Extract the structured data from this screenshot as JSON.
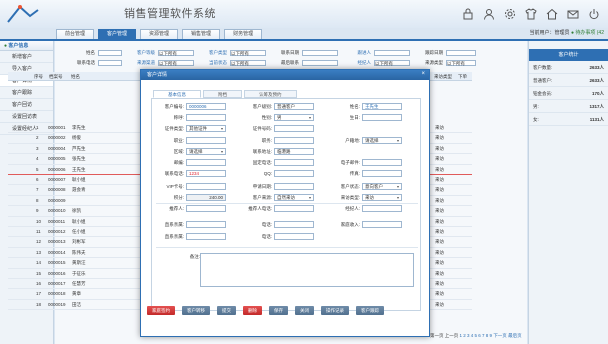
{
  "app": {
    "title": "销售管理软件系统"
  },
  "nav_tabs": [
    "前台管理",
    "客户管理",
    "资源管理",
    "销售管理",
    "财务管理"
  ],
  "header_icons": [
    "lock-icon",
    "user-icon",
    "gear-icon",
    "shirt-icon",
    "home-icon",
    "email-icon",
    "power-icon"
  ],
  "user_bar": {
    "label": "当前用户：",
    "user": "管理员",
    "pending": "待办事项 (42"
  },
  "sidebar": {
    "title": "客户信息",
    "items": [
      "新增客户",
      "导入客户",
      "客户详情",
      "客户跟踪",
      "客户回访",
      "设置回访表",
      "设置经纪人"
    ]
  },
  "filters": {
    "row1": [
      {
        "label": "姓名"
      },
      {
        "label": "客户等级",
        "value": "以下所有"
      },
      {
        "label": "客户类型",
        "value": "以下所有"
      },
      {
        "label": "联系日期"
      },
      {
        "label": "跟进人"
      },
      {
        "label": "跟踪日期"
      }
    ],
    "row2": [
      {
        "label": "联系电话"
      },
      {
        "label": "来源渠道",
        "value": "以下所有"
      },
      {
        "label": "当前状态",
        "value": "以下所有"
      },
      {
        "label": "最后联系"
      },
      {
        "label": "经纪人",
        "value": "以下所有"
      },
      {
        "label": "来源类型",
        "value": "以下所有"
      }
    ]
  },
  "grid": {
    "headers": [
      "序号",
      "档案号",
      "姓名",
      "部门",
      "来访类型",
      "下单"
    ],
    "rows": [
      {
        "no": "1",
        "id": "0000001",
        "name": "李先生",
        "type": "来访"
      },
      {
        "no": "2",
        "id": "0000002",
        "name": "杨俊",
        "type": "来访"
      },
      {
        "no": "3",
        "id": "0000004",
        "name": "芦先生",
        "type": "来访"
      },
      {
        "no": "4",
        "id": "0000005",
        "name": "张先生",
        "type": "来访"
      },
      {
        "no": "5",
        "id": "0000006",
        "name": "王先生",
        "type": "来访"
      },
      {
        "no": "6",
        "id": "0000007",
        "name": "耿小姐",
        "type": "来访"
      },
      {
        "no": "7",
        "id": "0000008",
        "name": "聂会青",
        "type": "来访"
      },
      {
        "no": "8",
        "id": "0000009",
        "name": "",
        "type": "来访"
      },
      {
        "no": "9",
        "id": "0000010",
        "name": "徐凯",
        "type": "来访"
      },
      {
        "no": "10",
        "id": "0000011",
        "name": "耿小姐",
        "type": "来访"
      },
      {
        "no": "11",
        "id": "0000012",
        "name": "任小姐",
        "type": "来访"
      },
      {
        "no": "12",
        "id": "0000013",
        "name": "刘彬军",
        "type": "来访"
      },
      {
        "no": "13",
        "id": "0000014",
        "name": "陈伟夫",
        "type": "来访"
      },
      {
        "no": "14",
        "id": "0000015",
        "name": "黄斯汪",
        "type": "来访"
      },
      {
        "no": "15",
        "id": "0000016",
        "name": "于征乐",
        "type": "来访"
      },
      {
        "no": "16",
        "id": "0000017",
        "name": "任慧芳",
        "type": "来访"
      },
      {
        "no": "17",
        "id": "0000018",
        "name": "黄章",
        "type": "来访"
      },
      {
        "no": "18",
        "id": "0000019",
        "name": "田洁",
        "type": "来访"
      }
    ]
  },
  "right_panel": {
    "title": "客户统计",
    "rows": [
      {
        "label": "客户数量:",
        "value": "2633人"
      },
      {
        "label": "普通客户:",
        "value": "2633人"
      },
      {
        "label": "铂金会员:",
        "value": "170人"
      },
      {
        "label": "男:",
        "value": "1317人"
      },
      {
        "label": "女:",
        "value": "1131人"
      }
    ]
  },
  "pager": {
    "text": "第一页 上一页",
    "pages": "1 2 3 4 5 6 7 8 9",
    "next": "下一页",
    "last": "最后页"
  },
  "modal": {
    "title": "客户详情",
    "close": "×",
    "tabs": [
      "基本信息",
      "附档",
      "认筹及预约"
    ],
    "fields": {
      "cust_no": {
        "label": "客户编号:",
        "value": "0000006"
      },
      "level": {
        "label": "客户级别:",
        "value": "普通客户"
      },
      "name": {
        "label": "姓名:",
        "value": "王先生"
      },
      "title": {
        "label": "称呼:",
        "value": ""
      },
      "gender": {
        "label": "性别:",
        "value": "男"
      },
      "birthday": {
        "label": "生日:",
        "value": ""
      },
      "id_type": {
        "label": "证件类型:",
        "value": "其他证件"
      },
      "id_no": {
        "label": "证件号码:",
        "value": ""
      },
      "job": {
        "label": "职业:",
        "value": ""
      },
      "position": {
        "label": "职务:",
        "value": ""
      },
      "hukou": {
        "label": "户籍地:",
        "value": "请选择"
      },
      "region": {
        "label": "区域:",
        "value": "请选择"
      },
      "address": {
        "label": "联系地址:",
        "value": "临港路"
      },
      "postcode": {
        "label": "邮编:",
        "value": ""
      },
      "phone": {
        "label": "固定电话:",
        "value": ""
      },
      "email": {
        "label": "电子邮件:",
        "value": ""
      },
      "mobile": {
        "label": "联系电话:",
        "value": "1234"
      },
      "qq": {
        "label": "QQ:",
        "value": ""
      },
      "fax": {
        "label": "传真:",
        "value": ""
      },
      "vip": {
        "label": "VIP卡号:",
        "value": ""
      },
      "visit_date": {
        "label": "申请日期:",
        "value": ""
      },
      "status": {
        "label": "客户状态:",
        "value": "意向客户"
      },
      "points": {
        "label": "积分:",
        "value": "240.00"
      },
      "source": {
        "label": "客户来源:",
        "value": "自然来访"
      },
      "visit_type": {
        "label": "来访类型:",
        "value": "来访"
      },
      "referrer": {
        "label": "推荐人:",
        "value": ""
      },
      "ref_phone": {
        "label": "推荐人电话:",
        "value": ""
      },
      "agent": {
        "label": "经纪人:",
        "value": ""
      },
      "family1": {
        "label": "直系亲属:",
        "value": ""
      },
      "phone1": {
        "label": "电话:",
        "value": ""
      },
      "income": {
        "label": "家庭收入:",
        "value": ""
      },
      "family2": {
        "label": "直系亲属:",
        "value": ""
      },
      "phone2": {
        "label": "电话:",
        "value": ""
      },
      "remark": {
        "label": "备注:",
        "value": ""
      }
    },
    "buttons": [
      "家庭签约",
      "客户转移",
      "提交",
      "删除",
      "保存",
      "关闭",
      "操作记录",
      "客户跟踪"
    ]
  }
}
